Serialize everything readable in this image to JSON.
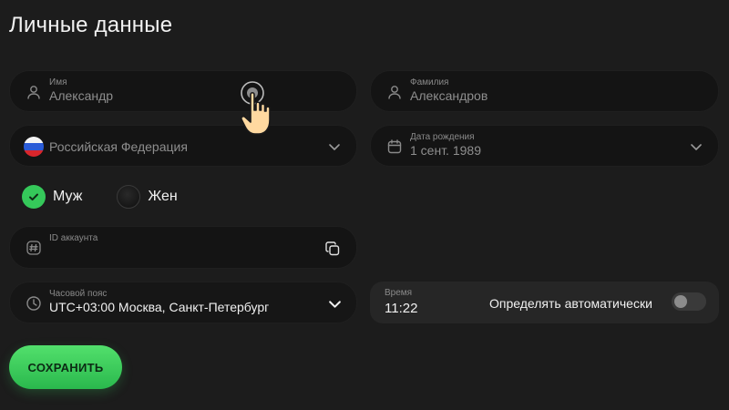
{
  "page": {
    "title": "Личные данные"
  },
  "first_name": {
    "label": "Имя",
    "value": "Александр"
  },
  "last_name": {
    "label": "Фамилия",
    "value": "Александров"
  },
  "country": {
    "value": "Российская Федерация",
    "flag_icon": "russia-flag-icon"
  },
  "birth_date": {
    "label": "Дата рождения",
    "value": "1 сент. 1989"
  },
  "gender": {
    "options": [
      {
        "label": "Муж",
        "selected": true
      },
      {
        "label": "Жен",
        "selected": false
      }
    ]
  },
  "account_id": {
    "label": "ID аккаунта",
    "value": ""
  },
  "timezone": {
    "label": "Часовой пояс",
    "value": "UTC+03:00 Москва, Санкт-Петербург"
  },
  "time": {
    "label": "Время",
    "value": "11:22",
    "auto_label": "Определять автоматически",
    "auto_enabled": false
  },
  "save_button": {
    "label": "СОХРАНИТЬ"
  },
  "colors": {
    "accent": "#35c85a",
    "background": "#1c1c1c",
    "field": "#141414"
  }
}
